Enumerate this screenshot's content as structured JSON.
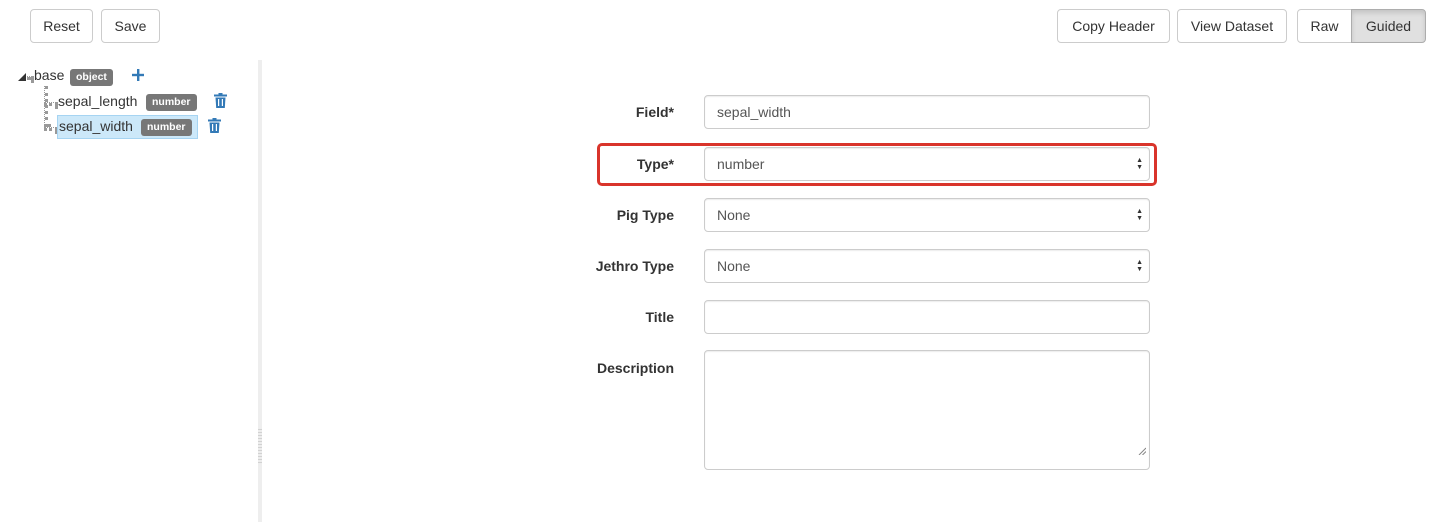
{
  "toolbar": {
    "reset_label": "Reset",
    "save_label": "Save",
    "copy_header_label": "Copy Header",
    "view_dataset_label": "View Dataset",
    "raw_label": "Raw",
    "guided_label": "Guided"
  },
  "tree": {
    "root": {
      "label": "base",
      "badge": "object"
    },
    "children": [
      {
        "label": "sepal_length",
        "badge": "number"
      },
      {
        "label": "sepal_width",
        "badge": "number"
      }
    ]
  },
  "form": {
    "field": {
      "label": "Field*",
      "value": "sepal_width"
    },
    "type": {
      "label": "Type*",
      "value": "number"
    },
    "pig_type": {
      "label": "Pig Type",
      "value": "None"
    },
    "jethro_type": {
      "label": "Jethro Type",
      "value": "None"
    },
    "title": {
      "label": "Title",
      "value": ""
    },
    "description": {
      "label": "Description",
      "value": ""
    }
  },
  "colors": {
    "accent_blue": "#337ab7",
    "badge_gray": "#777777",
    "selected_bg": "#cce8f9",
    "highlight_red": "#d9342b"
  },
  "icons": [
    "add-icon",
    "trash-icon",
    "expand-icon",
    "select-arrows-icon",
    "resize-grip-icon"
  ]
}
